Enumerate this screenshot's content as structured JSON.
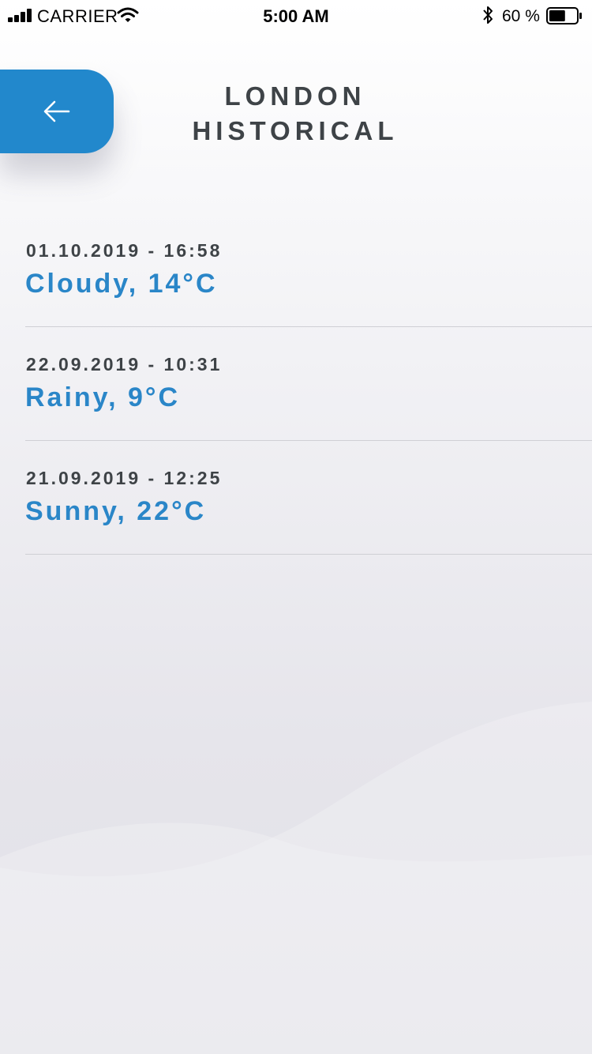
{
  "status_bar": {
    "carrier": "CARRIER",
    "time": "5:00 AM",
    "battery_percent": "60 %",
    "battery_level": 0.6
  },
  "header": {
    "back_icon": "arrow-left-icon",
    "title_line1": "LONDON",
    "title_line2": "HISTORICAL"
  },
  "history": [
    {
      "datetime": "01.10.2019 - 16:58",
      "weather": "Cloudy, 14°C"
    },
    {
      "datetime": "22.09.2019 - 10:31",
      "weather": "Rainy, 9°C"
    },
    {
      "datetime": "21.09.2019 - 12:25",
      "weather": "Sunny, 22°C"
    }
  ],
  "colors": {
    "accent": "#2288cc",
    "weather_text": "#2a86c8",
    "heading_text": "#3e4347",
    "divider": "#cfcfd5"
  }
}
